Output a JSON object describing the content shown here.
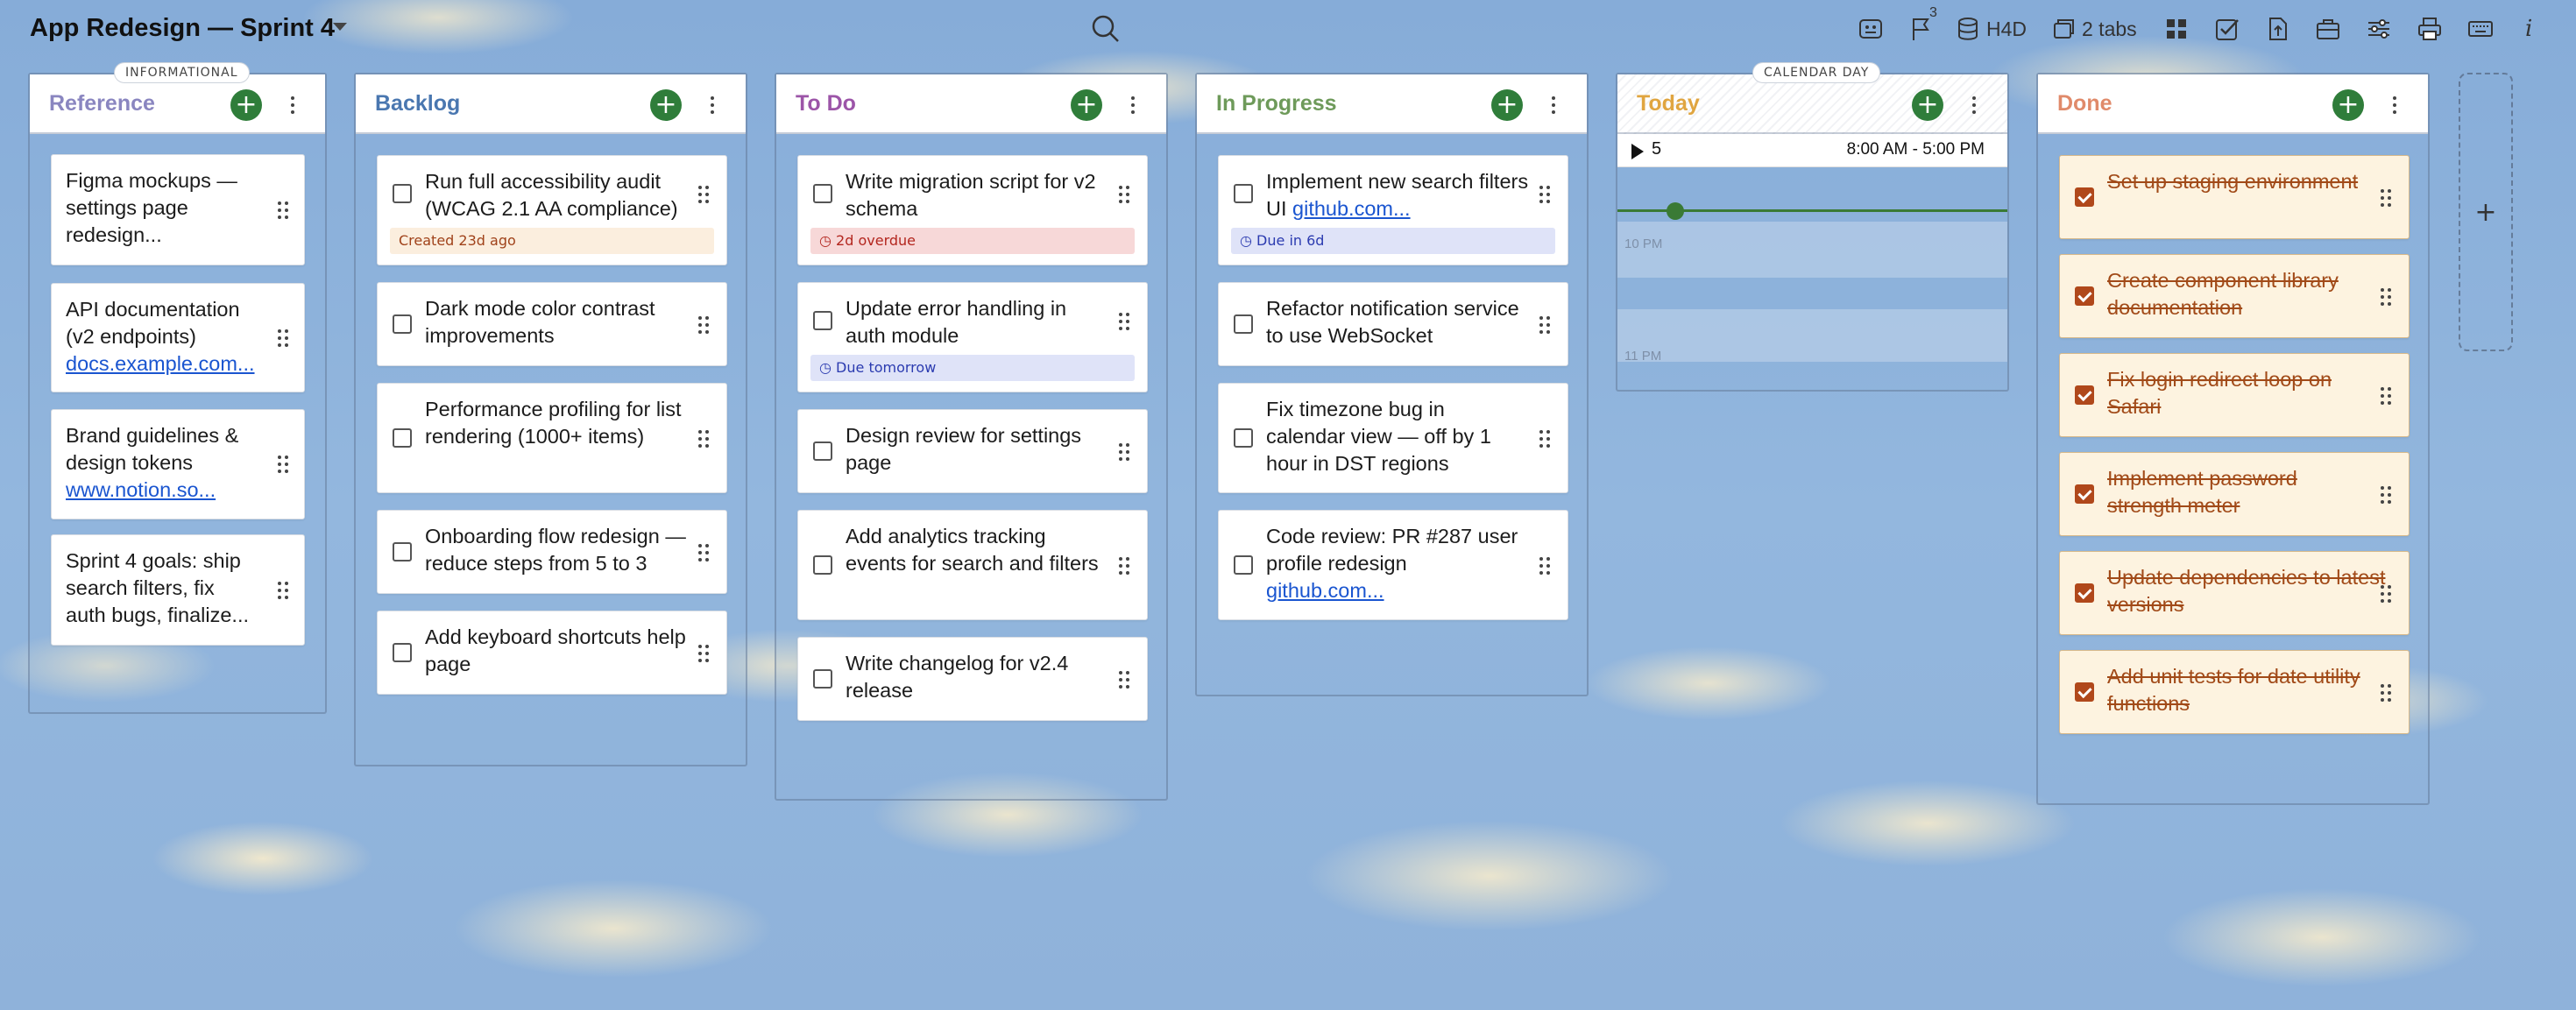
{
  "header": {
    "board_title": "App Redesign — Sprint 4",
    "flag_count": "3",
    "storage_label": "H4D",
    "tabs_label": "2 tabs"
  },
  "columns": [
    {
      "id": "reference",
      "title": "Reference",
      "title_color": "#8a86c0",
      "tag": "INFORMATIONAL",
      "cards": [
        {
          "text": "Figma mockups — settings page redesign..."
        },
        {
          "text": "API documentation (v2 endpoints)",
          "link": "docs.example.com..."
        },
        {
          "text": "Brand guidelines & design tokens",
          "link": "www.notion.so..."
        },
        {
          "text": "Sprint 4 goals: ship search filters, fix auth bugs, finalize..."
        }
      ]
    },
    {
      "id": "backlog",
      "title": "Backlog",
      "title_color": "#4a77b0",
      "cards": [
        {
          "text": "Run full accessibility audit (WCAG 2.1 AA compliance)",
          "badge": "Created 23d ago"
        },
        {
          "text": "Dark mode color contrast improvements"
        },
        {
          "text": "Performance profiling for list rendering (1000+ items)"
        },
        {
          "text": "Onboarding flow redesign — reduce steps from 5 to 3"
        },
        {
          "text": "Add keyboard shortcuts help page"
        }
      ]
    },
    {
      "id": "todo",
      "title": "To Do",
      "title_color": "#9c55a8",
      "cards": [
        {
          "text": "Write migration script for v2 schema",
          "badge": "2d overdue"
        },
        {
          "text": "Update error handling in auth module",
          "badge": "Due tomorrow"
        },
        {
          "text": "Design review for settings page"
        },
        {
          "text": "Add analytics tracking events for search and filters"
        },
        {
          "text": "Write changelog for v2.4 release"
        }
      ]
    },
    {
      "id": "inprogress",
      "title": "In Progress",
      "title_color": "#6e9a5a",
      "cards": [
        {
          "text": "Implement new search filters UI",
          "link": "github.com...",
          "badge": "Due in 6d"
        },
        {
          "text": "Refactor notification service to use WebSocket"
        },
        {
          "text": "Fix timezone bug in calendar view — off by 1 hour in DST regions"
        },
        {
          "text": "Code review: PR #287 user profile redesign",
          "link": "github.com..."
        }
      ]
    },
    {
      "id": "today",
      "title": "Today",
      "title_color": "#e0a540",
      "tag": "CALENDAR DAY",
      "day": "5",
      "hours": "8:00 AM - 5:00 PM",
      "hour_labels": [
        "10 PM",
        "11 PM"
      ]
    },
    {
      "id": "done",
      "title": "Done",
      "title_color": "#e08a6a",
      "cards": [
        {
          "text": "Set up staging environment"
        },
        {
          "text": "Create component library documentation"
        },
        {
          "text": "Fix login redirect loop on Safari"
        },
        {
          "text": "Implement password strength meter"
        },
        {
          "text": "Update dependencies to latest versions"
        },
        {
          "text": "Add unit tests for date utility functions"
        }
      ]
    }
  ],
  "icons": {
    "search": "search-icon",
    "toolbar": [
      "keyboard-shortcut-icon",
      "flag-icon",
      "database-icon",
      "tabs-icon",
      "grid-icon",
      "checkbox-icon",
      "export-icon",
      "briefcase-icon",
      "sliders-icon",
      "print-icon",
      "keyboard-icon",
      "info-icon"
    ]
  },
  "colors": {
    "accent_green": "#2f7d3a",
    "done_text": "#a14a18",
    "link": "#1a55d0"
  }
}
